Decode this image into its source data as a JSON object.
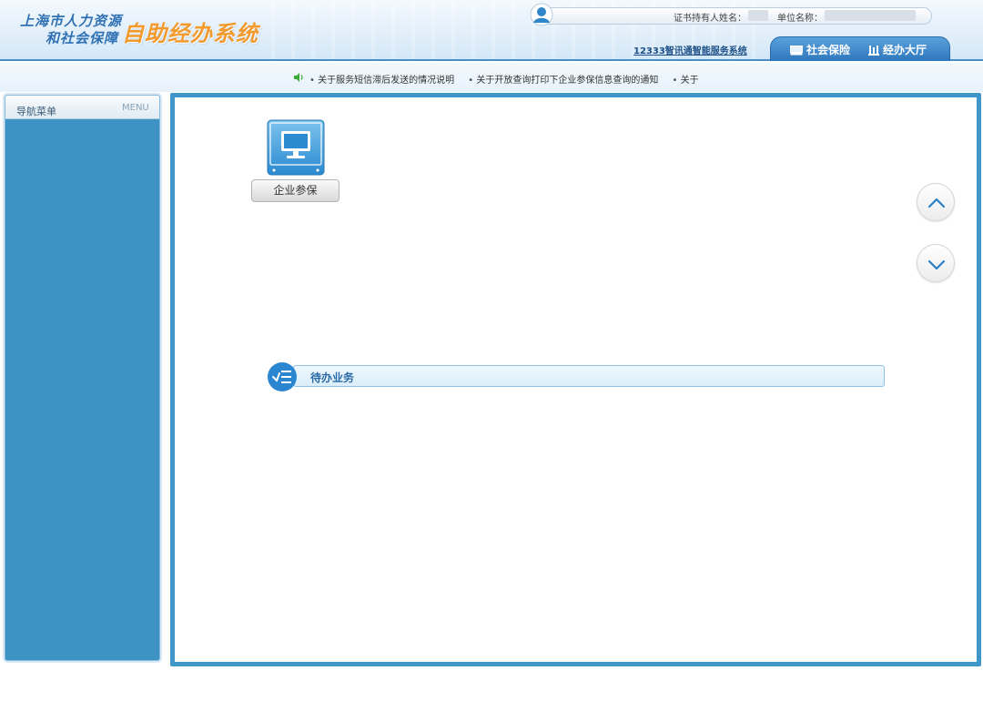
{
  "header": {
    "logo_line1": "上海市人力资源",
    "logo_line2": "和社会保障",
    "system_name": "自助经办系统",
    "holder_label": "证书持有人姓名：",
    "unit_label": "单位名称：",
    "link_12333": "12333智讯通智能服务系统",
    "tabs": [
      {
        "label": "社会保险",
        "icon": "monitor-icon"
      },
      {
        "label": "经办大厅",
        "icon": "building-icon"
      }
    ]
  },
  "notices": [
    "关于服务短信滞后发送的情况说明",
    "关于开放查询打印下企业参保信息查询的通知",
    "关于"
  ],
  "sidebar": {
    "title": "导航菜单",
    "title_en": "MENU"
  },
  "main": {
    "shortcut": {
      "label": "企业参保",
      "icon": "computer-monitor-icon"
    },
    "todo": {
      "label": "待办业务",
      "icon": "checklist-icon"
    },
    "scroll_up_icon": "chevron-up-icon",
    "scroll_down_icon": "chevron-down-icon"
  },
  "colors": {
    "brand_blue": "#2f71b3",
    "accent_orange": "#f29a2e",
    "sidebar_blue": "#3d94c4",
    "frame_blue": "#3f97c9"
  }
}
